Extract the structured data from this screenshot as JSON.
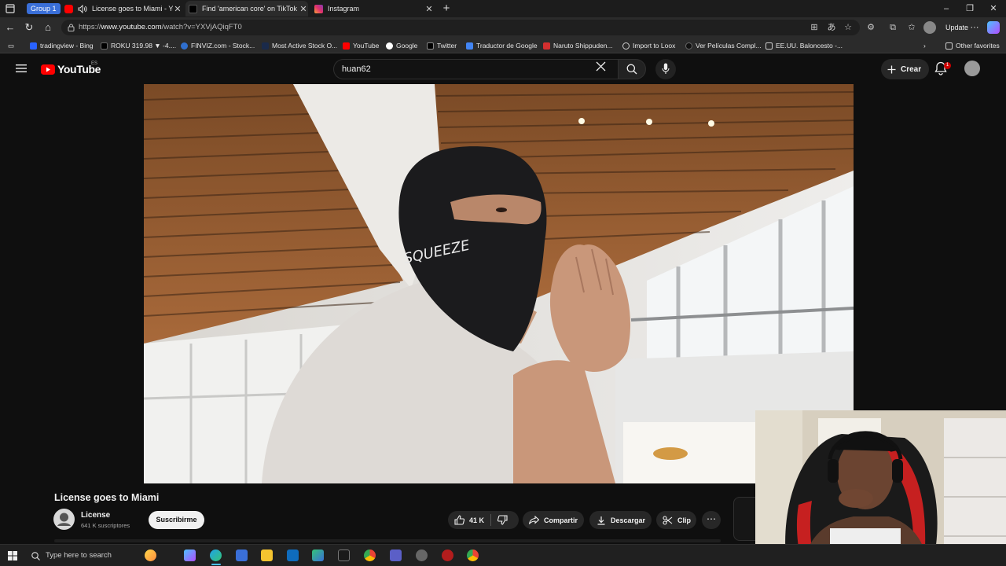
{
  "browser": {
    "tab_group_label": "Group 1",
    "tabs": [
      {
        "title": "License goes to Miami - You",
        "active": false
      },
      {
        "title": "Find 'american core' on TikTok | T",
        "active": true
      },
      {
        "title": "Instagram",
        "active": false
      }
    ],
    "url_prefix": "https://",
    "url_domain": "www.youtube.com",
    "url_path": "/watch?v=YXVjAQiqFT0",
    "update_label": "Update",
    "bookmarks": [
      "tradingview - Bing",
      "ROKU 319.98 ▼ -4....",
      "FINVIZ.com - Stock...",
      "Most Active Stock O...",
      "YouTube",
      "Google",
      "Twitter",
      "Traductor de Google",
      "Naruto Shippuden...",
      "Import to Loox",
      "Ver Películas Compl...",
      "EE.UU. Baloncesto -..."
    ],
    "other_favorites": "Other favorites"
  },
  "youtube": {
    "logo_text": "YouTube",
    "region": "ES",
    "search_value": "huan62",
    "create_label": "Crear",
    "notification_count": "1"
  },
  "video": {
    "title": "License goes to Miami",
    "channel_name": "License",
    "subscribers": "641 K suscriptores",
    "subscribe_label": "Suscribirme",
    "likes": "41 K",
    "share_label": "Compartir",
    "download_label": "Descargar",
    "clip_label": "Clip",
    "mask_text": "SQUEEZE"
  },
  "taskbar": {
    "search_placeholder": "Type here to search"
  },
  "colors": {
    "youtube_red": "#ff0000",
    "tab_group": "#3a6fd8",
    "background": "#0f0f0f"
  }
}
